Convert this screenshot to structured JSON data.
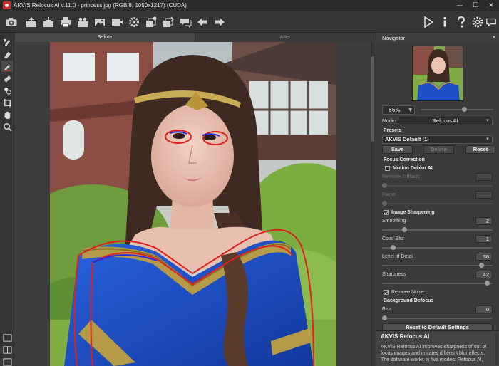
{
  "window": {
    "title": "AKVIS Refocus AI v.11.0 - princess.jpg (RGB/8, 1050x1217) (CUDA)",
    "minimize": "—",
    "maximize": "☐",
    "close": "✕"
  },
  "toolbar": {
    "left_icons": [
      "camera-icon",
      "open-file-icon",
      "save-file-icon",
      "print-icon",
      "share-icon",
      "image-icon",
      "export-icon",
      "settings-gear-icon",
      "batch-icon",
      "batch-2-icon",
      "messages-icon",
      "undo-icon",
      "redo-icon"
    ],
    "right_icons": [
      "run-icon",
      "info-icon",
      "help-icon",
      "preferences-icon",
      "chat-icon"
    ]
  },
  "tools": [
    "focus-brush-icon",
    "eraser-icon",
    "hand-pen-icon",
    "erase-icon",
    "sampler-icon",
    "crop-icon",
    "hand-icon",
    "zoom-icon"
  ],
  "view_tabs": {
    "before": "Before",
    "after": "After"
  },
  "navigator": {
    "title": "Navigator",
    "zoom": "66%",
    "zoom_fraction": 0.6
  },
  "settings": {
    "mode_label": "Mode:",
    "mode_value": "Refocus AI",
    "presets_label": "Presets",
    "preset_value": "AKVIS Default (1)",
    "save": "Save",
    "delete": "Delete",
    "reset": "Reset",
    "focus_correction": "Focus Correction",
    "motion_deblur": "Motion Deblur AI",
    "remove_artifacts": "Remove Artifacts",
    "focus": "Focus",
    "image_sharpening": "Image Sharpening",
    "smoothing": {
      "label": "Smoothing",
      "value": "2",
      "fraction": 0.2
    },
    "color_blur": {
      "label": "Color Blur",
      "value": "1",
      "fraction": 0.1
    },
    "level_of_detail": {
      "label": "Level of Detail",
      "value": "36",
      "fraction": 0.9
    },
    "sharpness": {
      "label": "Sharpness",
      "value": "42",
      "fraction": 0.95
    },
    "remove_noise": "Remove Noise",
    "background_defocus": "Background Defocus",
    "blur": {
      "label": "Blur",
      "value": "0",
      "fraction": 0.0
    },
    "reset_default": "Reset to Default Settings"
  },
  "info": {
    "title": "AKVIS Refocus AI",
    "text_1": "AKVIS Refocus AI improves sharpness of out of",
    "text_2": "focus images and imitates different blur effects.",
    "text_3": "The software works in five modes: Refocus AI,"
  },
  "colors": {
    "accent": "#e6e6e6",
    "dress": "#1b4fc4",
    "red_outline": "#e0201e"
  }
}
